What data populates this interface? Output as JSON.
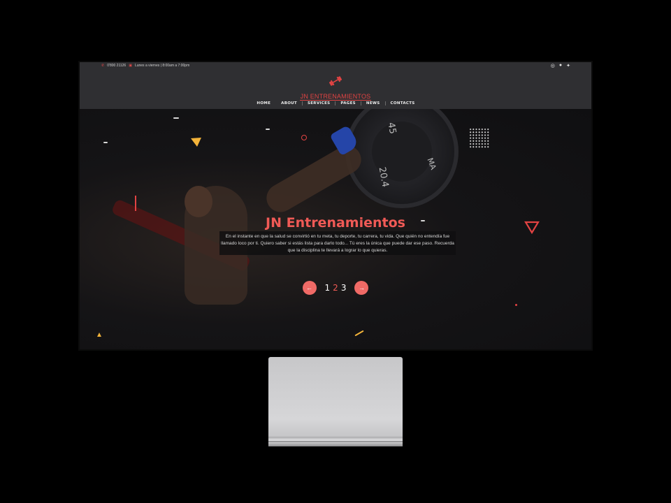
{
  "topbar": {
    "phone": "0'800 21126",
    "hours": "Lunes a viernes | 8:00am a 7:00pm",
    "social": [
      "instagram-icon",
      "facebook-icon",
      "twitter-icon"
    ]
  },
  "header": {
    "brand": "JN ENTRENAMIENTOS",
    "logo_icon": "dumbbell-icon",
    "nav": [
      "HOME",
      "ABOUT",
      "SERVICES",
      "PAGES",
      "NEWS",
      "CONTACTS"
    ]
  },
  "hero": {
    "title": "JN Entrenamientos",
    "text": "En el instante en que la salud se convirtió en tu meta, tu deporte, tu carrera, tu vida. Que quién no entendía fue llamado loco por ti. Quiero saber si estás lista para darlo todo... Tú eres la única que puede dar ese paso. Recuerda que la disciplina te llevará a lograr lo que quieras.",
    "pager": {
      "prev": "←",
      "next": "→",
      "pages": [
        "1",
        "2",
        "3"
      ],
      "active": "2"
    }
  },
  "colors": {
    "accent": "#e24343",
    "button": "#f06a66",
    "header_bg": "#2f2f32"
  }
}
